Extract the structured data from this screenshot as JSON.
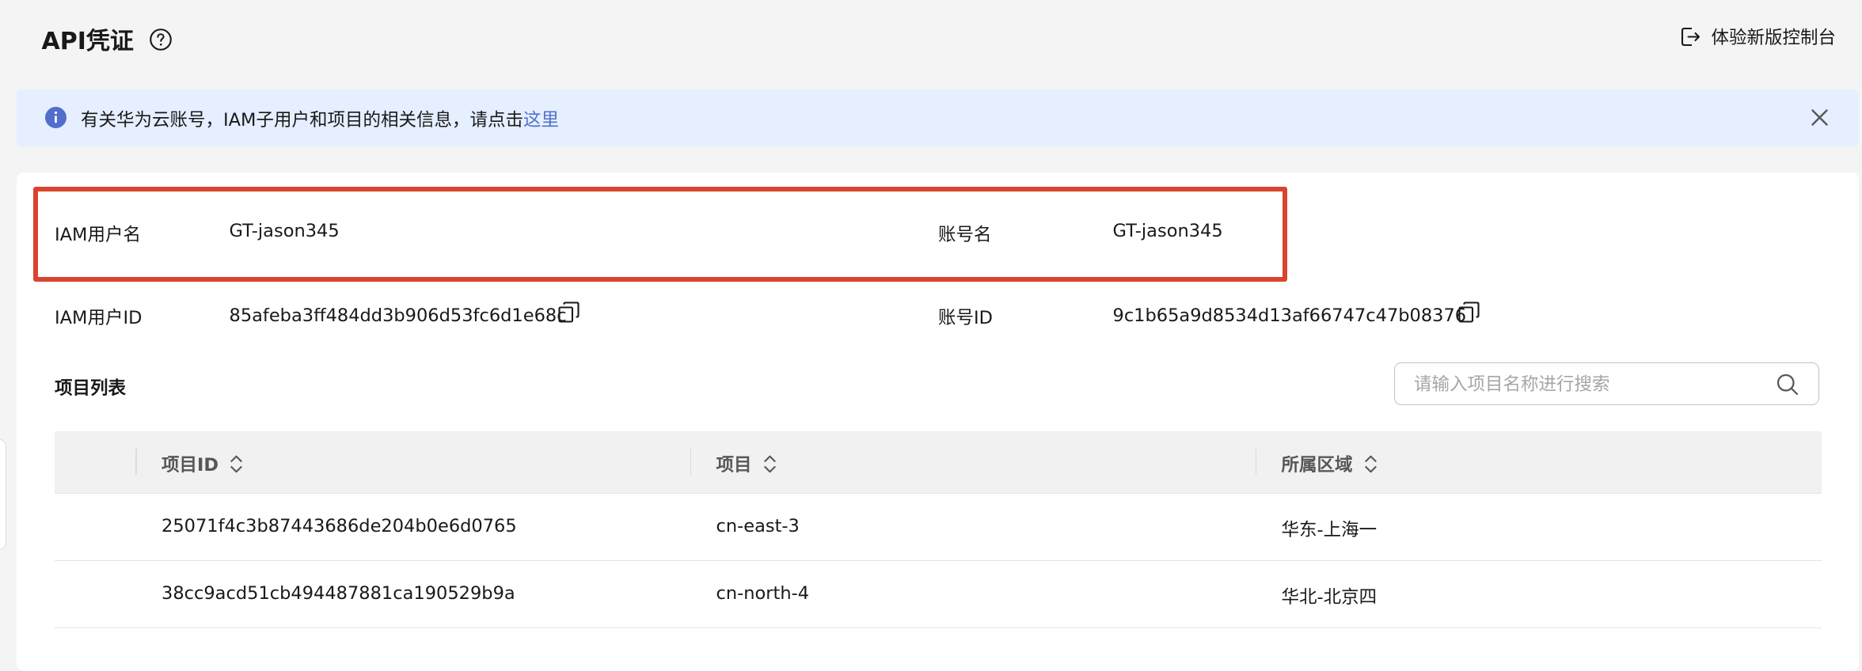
{
  "header": {
    "title": "API凭证",
    "try_new_console": "体验新版控制台"
  },
  "notice": {
    "text": "有关华为云账号，IAM子用户和项目的相关信息，请点击",
    "link": "这里"
  },
  "account": {
    "iam_username_label": "IAM用户名",
    "iam_username": "GT-jason345",
    "account_name_label": "账号名",
    "account_name": "GT-jason345",
    "iam_user_id_label": "IAM用户ID",
    "iam_user_id": "85afeba3ff484dd3b906d53fc6d1e68c",
    "account_id_label": "账号ID",
    "account_id": "9c1b65a9d8534d13af66747c47b08376"
  },
  "projects": {
    "title": "项目列表",
    "search_placeholder": "请输入项目名称进行搜索",
    "columns": [
      "项目ID",
      "项目",
      "所属区域"
    ],
    "rows": [
      {
        "id": "25071f4c3b87443686de204b0e6d0765",
        "project": "cn-east-3",
        "region": "华东-上海一"
      },
      {
        "id": "38cc9acd51cb494487881ca190529b9a",
        "project": "cn-north-4",
        "region": "华北-北京四"
      }
    ]
  },
  "colors": {
    "highlight": "#d9442f",
    "info": "#526ecc",
    "notice_bg": "#e5efff"
  }
}
